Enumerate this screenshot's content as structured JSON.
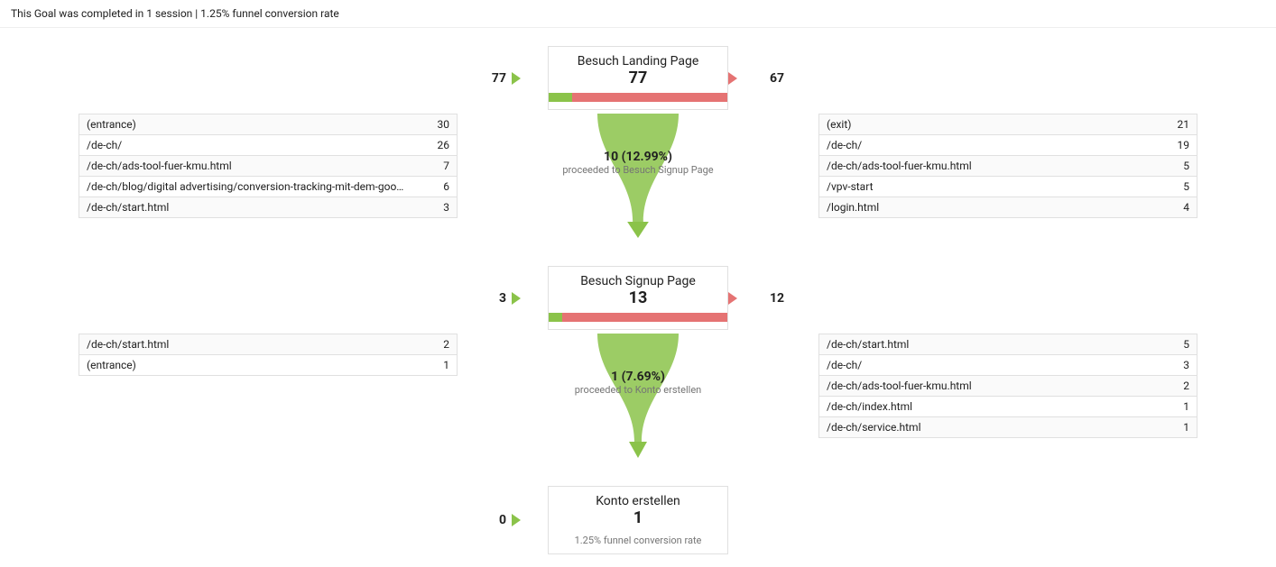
{
  "header": "This Goal was completed in 1 session | 1.25% funnel conversion rate",
  "steps": [
    {
      "title": "Besuch Landing Page",
      "count": "77",
      "in_count": "77",
      "out_count": "67",
      "green_pct": 12.99,
      "flow": {
        "number": "10 (12.99%)",
        "sub": "proceeded to Besuch Signup Page"
      },
      "in_paths": [
        {
          "path": "(entrance)",
          "n": "30"
        },
        {
          "path": "/de-ch/",
          "n": "26"
        },
        {
          "path": "/de-ch/ads-tool-fuer-kmu.html",
          "n": "7"
        },
        {
          "path": "/de-ch/blog/digital advertising/conversion-tracking-mit-dem-goo…",
          "n": "6"
        },
        {
          "path": "/de-ch/start.html",
          "n": "3"
        }
      ],
      "out_paths": [
        {
          "path": "(exit)",
          "n": "21"
        },
        {
          "path": "/de-ch/",
          "n": "19"
        },
        {
          "path": "/de-ch/ads-tool-fuer-kmu.html",
          "n": "5"
        },
        {
          "path": "/vpv-start",
          "n": "5"
        },
        {
          "path": "/login.html",
          "n": "4"
        }
      ]
    },
    {
      "title": "Besuch Signup Page",
      "count": "13",
      "in_count": "3",
      "out_count": "12",
      "green_pct": 7.69,
      "flow": {
        "number": "1 (7.69%)",
        "sub": "proceeded to Konto erstellen"
      },
      "in_paths": [
        {
          "path": "/de-ch/start.html",
          "n": "2"
        },
        {
          "path": "(entrance)",
          "n": "1"
        }
      ],
      "out_paths": [
        {
          "path": "/de-ch/start.html",
          "n": "5"
        },
        {
          "path": "/de-ch/",
          "n": "3"
        },
        {
          "path": "/de-ch/ads-tool-fuer-kmu.html",
          "n": "2"
        },
        {
          "path": "/de-ch/index.html",
          "n": "1"
        },
        {
          "path": "/de-ch/service.html",
          "n": "1"
        }
      ]
    },
    {
      "title": "Konto erstellen",
      "count": "1",
      "in_count": "0",
      "out_count": "",
      "green_pct": 100,
      "conv_rate": "1.25% funnel conversion rate",
      "in_paths": [],
      "out_paths": []
    }
  ],
  "chart_data": {
    "type": "funnel",
    "title": "Goal Funnel Visualization",
    "conversion_rate_overall": 1.25,
    "steps": [
      {
        "name": "Besuch Landing Page",
        "sessions": 77,
        "proceeded": 10,
        "dropoff": 67,
        "proceed_rate_pct": 12.99,
        "entries": 77
      },
      {
        "name": "Besuch Signup Page",
        "sessions": 13,
        "proceeded": 1,
        "dropoff": 12,
        "proceed_rate_pct": 7.69,
        "entries": 3
      },
      {
        "name": "Konto erstellen",
        "sessions": 1,
        "entries": 0
      }
    ],
    "inflows": {
      "Besuch Landing Page": [
        {
          "source": "(entrance)",
          "sessions": 30
        },
        {
          "source": "/de-ch/",
          "sessions": 26
        },
        {
          "source": "/de-ch/ads-tool-fuer-kmu.html",
          "sessions": 7
        },
        {
          "source": "/de-ch/blog/digital advertising/conversion-tracking-mit-dem-goo…",
          "sessions": 6
        },
        {
          "source": "/de-ch/start.html",
          "sessions": 3
        }
      ],
      "Besuch Signup Page": [
        {
          "source": "/de-ch/start.html",
          "sessions": 2
        },
        {
          "source": "(entrance)",
          "sessions": 1
        }
      ]
    },
    "outflows": {
      "Besuch Landing Page": [
        {
          "destination": "(exit)",
          "sessions": 21
        },
        {
          "destination": "/de-ch/",
          "sessions": 19
        },
        {
          "destination": "/de-ch/ads-tool-fuer-kmu.html",
          "sessions": 5
        },
        {
          "destination": "/vpv-start",
          "sessions": 5
        },
        {
          "destination": "/login.html",
          "sessions": 4
        }
      ],
      "Besuch Signup Page": [
        {
          "destination": "/de-ch/start.html",
          "sessions": 5
        },
        {
          "destination": "/de-ch/",
          "sessions": 3
        },
        {
          "destination": "/de-ch/ads-tool-fuer-kmu.html",
          "sessions": 2
        },
        {
          "destination": "/de-ch/index.html",
          "sessions": 1
        },
        {
          "destination": "/de-ch/service.html",
          "sessions": 1
        }
      ]
    }
  }
}
